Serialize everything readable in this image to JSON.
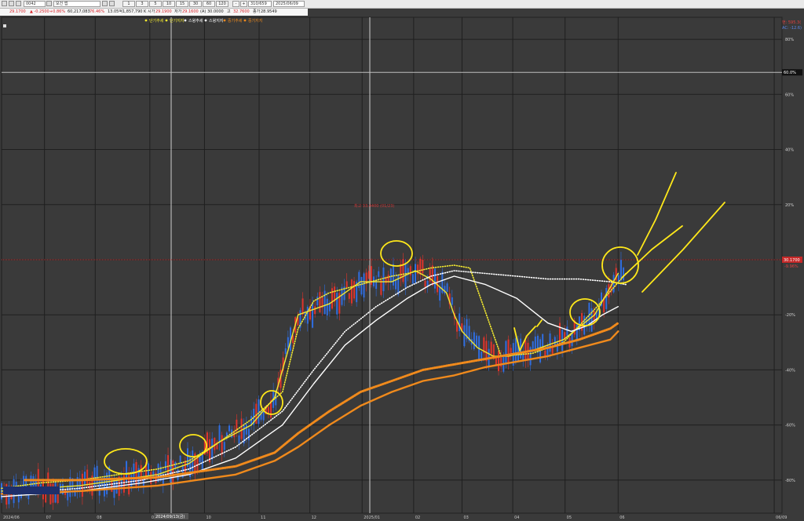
{
  "toolbar": {
    "symbol_code": "0042",
    "name": "모건 앱",
    "timeframes": [
      "1",
      "3",
      "5",
      "10",
      "15",
      "30",
      "60",
      "120"
    ],
    "count": "310/659",
    "date": "2025/06/09",
    "zoom_minus": "-",
    "zoom_plus": "+"
  },
  "quote": {
    "price": "29.1700",
    "change": "▲ -0.2500",
    "change_pct": "+0.86%",
    "volume": "60,217,083",
    "pct2": "76.46%",
    "turnover": "13.05억",
    "amount": "1,857,790 K",
    "label_open": "시가",
    "open": "29.1900",
    "label_low": "저가",
    "low": "29.1600",
    "label_adj": "(A)",
    "adj": "30.0000",
    "label_high": "고",
    "high": "32.7600",
    "label_close": "종가",
    "close": "28.9549"
  },
  "legend": {
    "items": [
      {
        "label": "단기추세",
        "color": "#f2e830"
      },
      {
        "label": "단기지지",
        "color": "#f2e830"
      },
      {
        "label": "스윙추세",
        "color": "#ffffff"
      },
      {
        "label": "스윙지지",
        "color": "#ffffff"
      },
      {
        "label": "중기추세",
        "color": "#f08a1c"
      },
      {
        "label": "중기지지",
        "color": "#f08a1c"
      }
    ]
  },
  "right_labels": {
    "top1": "현: 595.3(",
    "top2": "AC: -12.6)",
    "price_tag": "30.1700",
    "price_tag_pct": "-9.96%",
    "white_line_tag": "60.0%"
  },
  "peak_annotation": "최고 33.4400 (01/23)",
  "cursor_label": "2024/09/13(금)",
  "colors": {
    "background": "#3a3a3a",
    "grid": "#1f1f1f",
    "up_candle": "#e0342c",
    "down_candle": "#2f6de0",
    "short_trend": "#f2e830",
    "swing_trend": "#ffffff",
    "mid_trend": "#f08a1c",
    "hand_drawn": "#ffe81a",
    "price_line": "#c03030"
  },
  "chart_data": {
    "type": "candlestick",
    "title": "",
    "x_axis_dates": [
      "2024/06",
      "07",
      "08",
      "09",
      "10",
      "11",
      "12",
      "2025/01",
      "02",
      "03",
      "04",
      "05",
      "06",
      "06/09"
    ],
    "y_axis_labels": [
      "80%",
      "60%",
      "40%",
      "20%",
      "0%",
      "-20%",
      "-40%",
      "-60%",
      "-80%"
    ],
    "ylim": [
      -92,
      88
    ],
    "reference_price_pct": 0,
    "reference_line_pct": 68,
    "series": [
      {
        "name": "단기추세",
        "style": "dotted",
        "color": "#f2e830",
        "x": [
          0.0,
          0.05,
          0.1,
          0.15,
          0.2,
          0.24,
          0.28,
          0.32,
          0.36,
          0.38,
          0.4,
          0.42,
          0.46,
          0.5,
          0.52,
          0.55,
          0.58,
          0.6,
          0.64,
          0.68,
          0.72,
          0.76,
          0.8
        ],
        "y": [
          -83,
          -81,
          -80,
          -78,
          -76,
          -73,
          -66,
          -58,
          -48,
          -25,
          -15,
          -12,
          -9,
          -6,
          -5,
          -3,
          -2,
          -3,
          -35,
          -34,
          -30,
          -18,
          -5
        ]
      },
      {
        "name": "단기지지",
        "style": "solid",
        "color": "#f2e830",
        "x": [
          0.0,
          0.1,
          0.15,
          0.2,
          0.24,
          0.28,
          0.32,
          0.35,
          0.38,
          0.42,
          0.46,
          0.5,
          0.53,
          0.55,
          0.57,
          0.58,
          0.59,
          0.61,
          0.63,
          0.65,
          0.68,
          0.72,
          0.76,
          0.79
        ],
        "y": [
          -84,
          -82,
          -80,
          -78,
          -74,
          -66,
          -60,
          -50,
          -20,
          -16,
          -8,
          -8,
          -4,
          -7,
          -12,
          -20,
          -26,
          -32,
          -35,
          -35,
          -33,
          -29,
          -20,
          -5
        ]
      },
      {
        "name": "스윙추세",
        "style": "dotted",
        "color": "#ffffff",
        "x": [
          0.0,
          0.1,
          0.18,
          0.24,
          0.3,
          0.36,
          0.4,
          0.44,
          0.48,
          0.52,
          0.55,
          0.58,
          0.62,
          0.66,
          0.7,
          0.74,
          0.78,
          0.8
        ],
        "y": [
          -85,
          -83,
          -80,
          -76,
          -68,
          -55,
          -40,
          -26,
          -17,
          -10,
          -6,
          -4,
          -5,
          -6,
          -7,
          -7,
          -8,
          -9
        ]
      },
      {
        "name": "스윙지지",
        "style": "solid",
        "color": "#ffffff",
        "x": [
          0.0,
          0.1,
          0.18,
          0.24,
          0.3,
          0.36,
          0.4,
          0.44,
          0.48,
          0.52,
          0.55,
          0.58,
          0.62,
          0.66,
          0.7,
          0.73,
          0.75,
          0.77,
          0.79
        ],
        "y": [
          -86,
          -84,
          -81,
          -78,
          -72,
          -60,
          -45,
          -31,
          -22,
          -14,
          -9,
          -6,
          -9,
          -14,
          -23,
          -26,
          -24,
          -20,
          -17
        ]
      },
      {
        "name": "중기추세",
        "style": "dotted",
        "color": "#f08a1c",
        "x": [
          0.03,
          0.1,
          0.2,
          0.3,
          0.35,
          0.38,
          0.42,
          0.46,
          0.5,
          0.54,
          0.58,
          0.62,
          0.66,
          0.7,
          0.74,
          0.78,
          0.79
        ],
        "y": [
          -80,
          -80,
          -79,
          -75,
          -70,
          -63,
          -55,
          -48,
          -44,
          -40,
          -38,
          -36,
          -34,
          -32,
          -29,
          -25,
          -23
        ]
      },
      {
        "name": "중기지지",
        "style": "solid",
        "color": "#f08a1c",
        "x": [
          0.0,
          0.1,
          0.2,
          0.3,
          0.35,
          0.38,
          0.42,
          0.46,
          0.5,
          0.54,
          0.58,
          0.62,
          0.66,
          0.7,
          0.74,
          0.78,
          0.79
        ],
        "y": [
          -85,
          -84,
          -82,
          -78,
          -73,
          -68,
          -60,
          -53,
          -48,
          -44,
          -42,
          -39,
          -37,
          -35,
          -32,
          -29,
          -26
        ]
      }
    ]
  }
}
